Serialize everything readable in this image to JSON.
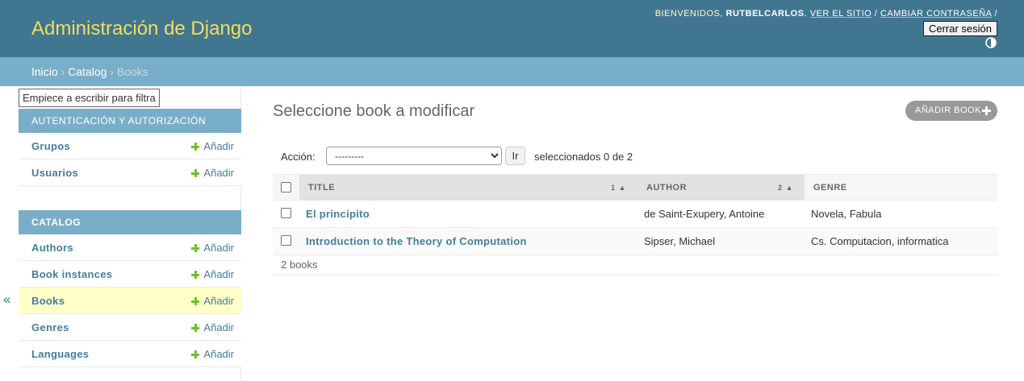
{
  "header": {
    "brand": "Administración de Django",
    "welcome": "BIENVENIDOS,",
    "username": "RUTBELCARLOS",
    "period": ".",
    "view_site": "VER EL SITIO",
    "separator": "/",
    "change_password": "CAMBIAR CONTRASEÑA",
    "trailing_separator": "/",
    "logout": "Cerrar sesión",
    "theme_toggle_icon": "half-circle-icon"
  },
  "breadcrumbs": {
    "home": "Inicio",
    "app": "Catalog",
    "current": "Books",
    "separator": "›"
  },
  "sidebar": {
    "filter_placeholder": "Empiece a escribir para filtrar...",
    "collapse_icon": "«",
    "modules": [
      {
        "caption": "AUTENTICACIÓN Y AUTORIZACIÓN",
        "items": [
          {
            "name": "Grupos",
            "add": "Añadir"
          },
          {
            "name": "Usuarios",
            "add": "Añadir"
          }
        ]
      },
      {
        "caption": "CATALOG",
        "items": [
          {
            "name": "Authors",
            "add": "Añadir"
          },
          {
            "name": "Book instances",
            "add": "Añadir"
          },
          {
            "name": "Books",
            "add": "Añadir",
            "selected": true
          },
          {
            "name": "Genres",
            "add": "Añadir"
          },
          {
            "name": "Languages",
            "add": "Añadir"
          }
        ]
      }
    ]
  },
  "content": {
    "title": "Seleccione book a modificar",
    "add_button": "AÑADIR BOOK",
    "actions": {
      "label": "Acción:",
      "select_value": "---------",
      "go": "Ir",
      "counter": "seleccionados 0 de 2"
    },
    "table": {
      "columns": [
        {
          "label": "TITLE",
          "sort_priority": "1",
          "sort_arrow": "▲"
        },
        {
          "label": "AUTHOR",
          "sort_priority": "2",
          "sort_arrow": "▲"
        },
        {
          "label": "GENRE"
        }
      ],
      "rows": [
        {
          "title": "El principito",
          "author": "de Saint-Exupery, Antoine",
          "genre": "Novela, Fabula"
        },
        {
          "title": "Introduction to the Theory of Computation",
          "author": "Sipser, Michael",
          "genre": "Cs. Computacion, informatica"
        }
      ]
    },
    "paginator": "2 books"
  },
  "colors": {
    "header_bg": "#417690",
    "brand": "#f5dd5d",
    "breadcrumbs_bg": "#79aec8",
    "link": "#447e9b",
    "add_green": "#70bf2b",
    "selected_row": "#ffffc8"
  }
}
